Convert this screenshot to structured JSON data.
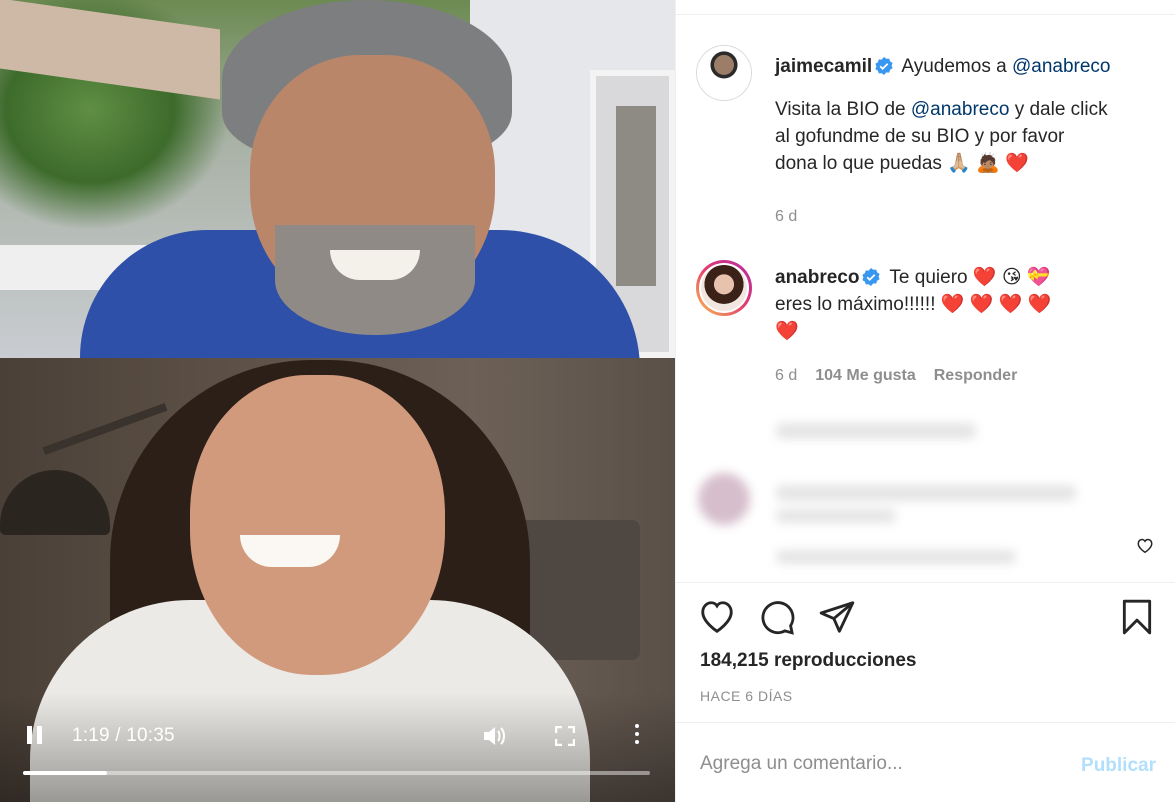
{
  "video": {
    "current_time": "1:19",
    "duration": "10:35",
    "time_display": "1:19 / 10:35",
    "progress_fraction": 0.134
  },
  "caption": {
    "username": "jaimecamil",
    "text_prefix": "Ayudemos a",
    "mention_1": "@anabreco",
    "line2_prefix": "Visita la BIO de",
    "mention_2": "@anabreco",
    "line2_suffix": "y dale click",
    "line3": "al gofundme de su BIO y por favor",
    "line4": "dona lo que puedas",
    "emojis": [
      "🙏🏼",
      "🙇🏽",
      "❤️"
    ],
    "time": "6 d"
  },
  "reply": {
    "username": "anabreco",
    "text_1": "Te quiero",
    "text_2": "eres lo máximo!!!!!!",
    "time": "6 d",
    "likes": "104 Me gusta",
    "reply_label": "Responder"
  },
  "stats": {
    "views": "184,215 reproducciones",
    "posted": "HACE 6 DÍAS"
  },
  "comment_form": {
    "placeholder": "Agrega un comentario...",
    "publish_label": "Publicar"
  },
  "icons": {
    "like": "heart-icon",
    "comment": "comment-icon",
    "share": "share-icon",
    "save": "bookmark-icon",
    "verified": "verified-badge-icon"
  },
  "colors": {
    "mention": "#00376b",
    "verified": "#3897f0",
    "publish_disabled": "#b2dffc",
    "secondary_text": "#8e8e8e"
  }
}
